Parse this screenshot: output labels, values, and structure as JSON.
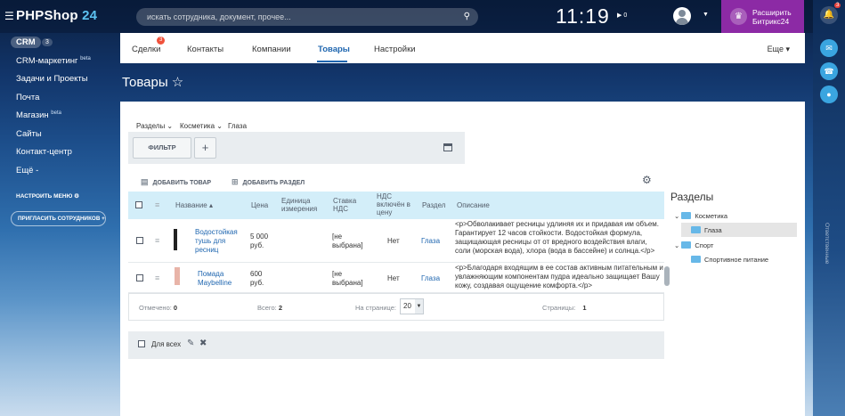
{
  "header": {
    "logo_main": "PHPShop",
    "logo_num": "24",
    "search_placeholder": "искать сотрудника, документ, прочее...",
    "clock": "11:19",
    "flag_count": "0",
    "upgrade_line1": "Расширить",
    "upgrade_line2": "Битрикс24",
    "notif_count": "3"
  },
  "sidebar": {
    "crm_label": "CRM",
    "crm_count": "3",
    "items": [
      {
        "label": "CRM-маркетинг",
        "sup": "beta"
      },
      {
        "label": "Задачи и Проекты",
        "sup": ""
      },
      {
        "label": "Почта",
        "sup": ""
      },
      {
        "label": "Магазин",
        "sup": "beta"
      },
      {
        "label": "Сайты",
        "sup": ""
      },
      {
        "label": "Контакт-центр",
        "sup": ""
      },
      {
        "label": "Ещё -",
        "sup": ""
      }
    ],
    "setup_menu": "НАСТРОИТЬ МЕНЮ",
    "invite": "ПРИГЛАСИТЬ СОТРУДНИКОВ"
  },
  "tabs": {
    "items": [
      "Сделки",
      "Контакты",
      "Компании",
      "Товары",
      "Настройки"
    ],
    "deals_badge": "3",
    "more": "Еще"
  },
  "page": {
    "title": "Товары"
  },
  "breadcrumb": [
    "Разделы",
    "Косметика",
    "Глаза"
  ],
  "toolbar": {
    "filter": "ФИЛЬТР",
    "add_product": "ДОБАВИТЬ ТОВАР",
    "add_section": "ДОБАВИТЬ РАЗДЕЛ"
  },
  "table": {
    "columns": [
      "Название",
      "Цена",
      "Единица измерения",
      "Ставка НДС",
      "НДС включён в цену",
      "Раздел",
      "Описание"
    ],
    "rows": [
      {
        "name": "Водостойкая тушь для ресниц",
        "price": "5 000 руб.",
        "unit": "",
        "vat": "[не выбрана]",
        "vat_included": "Нет",
        "section": "Глаза",
        "description": "<p>Обволакивает ресницы удлиняя их и придавая им объем. Гарантирует 12 часов стойкости. Водостойкая формула, защищающая ресницы от от вредного воздействия влаги, соли (морская вода), хлора (вода в бассейне) и солнца.</p>"
      },
      {
        "name": "Помада Maybelline",
        "price": "600 руб.",
        "unit": "",
        "vat": "[не выбрана]",
        "vat_included": "Нет",
        "section": "Глаза",
        "description": "<p>Благодаря входящим в ее состав активным питательным и увлажняющим компонентам пудра идеально защищает Вашу кожу, создавая ощущение комфорта.</p>"
      }
    ],
    "footer": {
      "marked_label": "Отмечено:",
      "marked": "0",
      "total_label": "Всего:",
      "total": "2",
      "per_page_label": "На странице:",
      "per_page": "20",
      "pages_label": "Страницы:",
      "pages": "1"
    },
    "for_all": "Для всех"
  },
  "sections": {
    "title": "Разделы",
    "tree": [
      "Косметика",
      "Глаза",
      "Спорт",
      "Спортивное питание"
    ]
  },
  "right_strip_text": "Ответственные",
  "colors": {
    "accent": "#2067b0",
    "upgrade": "#8c2aa5",
    "header_row": "#d3eef9"
  }
}
